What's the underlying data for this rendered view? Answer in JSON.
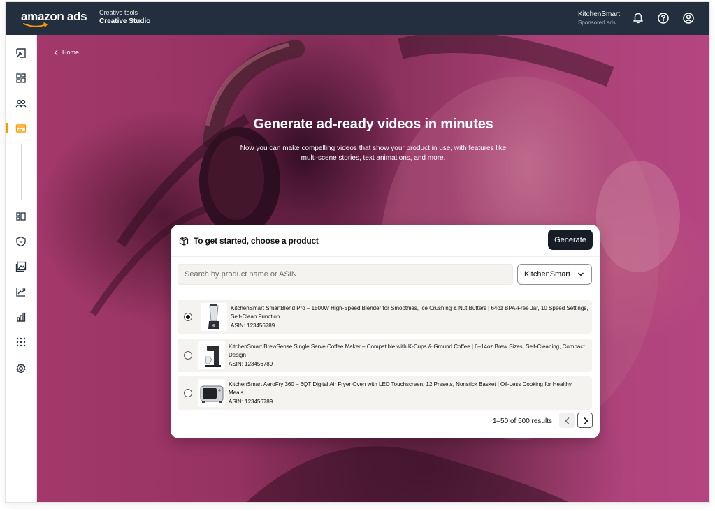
{
  "topbar": {
    "logo_text": "amazon ads",
    "context_label": "Creative tools",
    "context_title": "Creative Studio",
    "account_name": "KitchenSmart",
    "account_sub": "Sponsored ads",
    "icons": [
      "bell-icon",
      "help-icon",
      "account-icon"
    ]
  },
  "sidebar": {
    "icons": [
      "campaign-icon",
      "dashboard-icon",
      "audiences-icon",
      "creative-icon",
      "brand-stores-icon",
      "brand-safety-icon",
      "image-library-icon",
      "measurement-icon",
      "reports-icon",
      "apps-icon",
      "settings-icon"
    ],
    "accent_color": "#ff9900"
  },
  "breadcrumb": {
    "home_label": "Home"
  },
  "hero": {
    "title": "Generate ad-ready videos in minutes",
    "subtitle": "Now you can make compelling videos that show your product in use, with features like multi-scene stories, text animations, and more."
  },
  "card": {
    "title": "To get started, choose a product",
    "generate_label": "Generate",
    "search_placeholder": "Search by product name or ASIN",
    "search_value": "",
    "brand_selected": "KitchenSmart",
    "products": [
      {
        "title": "KitchenSmart SmartBlend Pro – 1500W High-Speed Blender for Smoothies, Ice Crushing & Nut Butters | 64oz BPA-Free Jar, 10 Speed Settings, Self-Clean Function",
        "asin": "ASIN: 123456789",
        "selected": true
      },
      {
        "title": "KitchenSmart BrewSense Single Serve Coffee Maker – Compatible with K-Cups & Ground Coffee | 6–14oz Brew Sizes, Self-Cleaning, Compact Design",
        "asin": "ASIN: 123456789",
        "selected": false
      },
      {
        "title": "KitchenSmart AeroFry 360 – 6QT Digital Air Fryer Oven with LED Touchscreen, 12 Presets, Nonstick Basket | Oil-Less Cooking for Healthy Meals",
        "asin": "ASIN: 123456789",
        "selected": false
      }
    ],
    "results_text": "1–50 of 500 results"
  },
  "colors": {
    "topbar_bg": "#232f3e",
    "button_dark": "#161d26",
    "row_bg": "#f5f3ef"
  }
}
